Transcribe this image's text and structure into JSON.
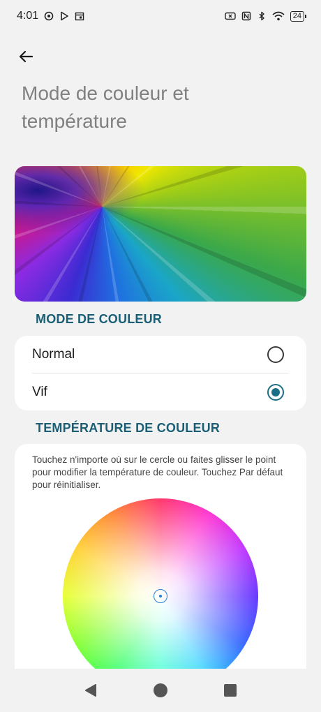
{
  "status_bar": {
    "time": "4:01",
    "battery": "24",
    "icons": [
      "chrome-icon",
      "play-store-icon",
      "calendar-icon",
      "screen-record-icon",
      "nfc-icon",
      "bluetooth-icon",
      "wifi-icon",
      "battery-icon"
    ]
  },
  "header": {
    "back_icon": "back-arrow-icon",
    "title": "Mode de couleur et température"
  },
  "color_mode": {
    "section_title": "MODE DE COULEUR",
    "options": [
      {
        "label": "Normal",
        "selected": false
      },
      {
        "label": "Vif",
        "selected": true
      }
    ]
  },
  "color_temperature": {
    "section_title": "TEMPÉRATURE DE COULEUR",
    "help_text": "Touchez n'importe où sur le cercle ou faites glisser le point pour modifier la température de couleur. Touchez Par défaut pour réinitialiser."
  },
  "nav_bar": {
    "buttons": [
      "back-triangle-icon",
      "home-circle-icon",
      "recents-square-icon"
    ]
  },
  "colors": {
    "accent": "#1a6f86",
    "section_header": "#1a5f76",
    "background": "#f2f2f2",
    "card": "#ffffff"
  }
}
